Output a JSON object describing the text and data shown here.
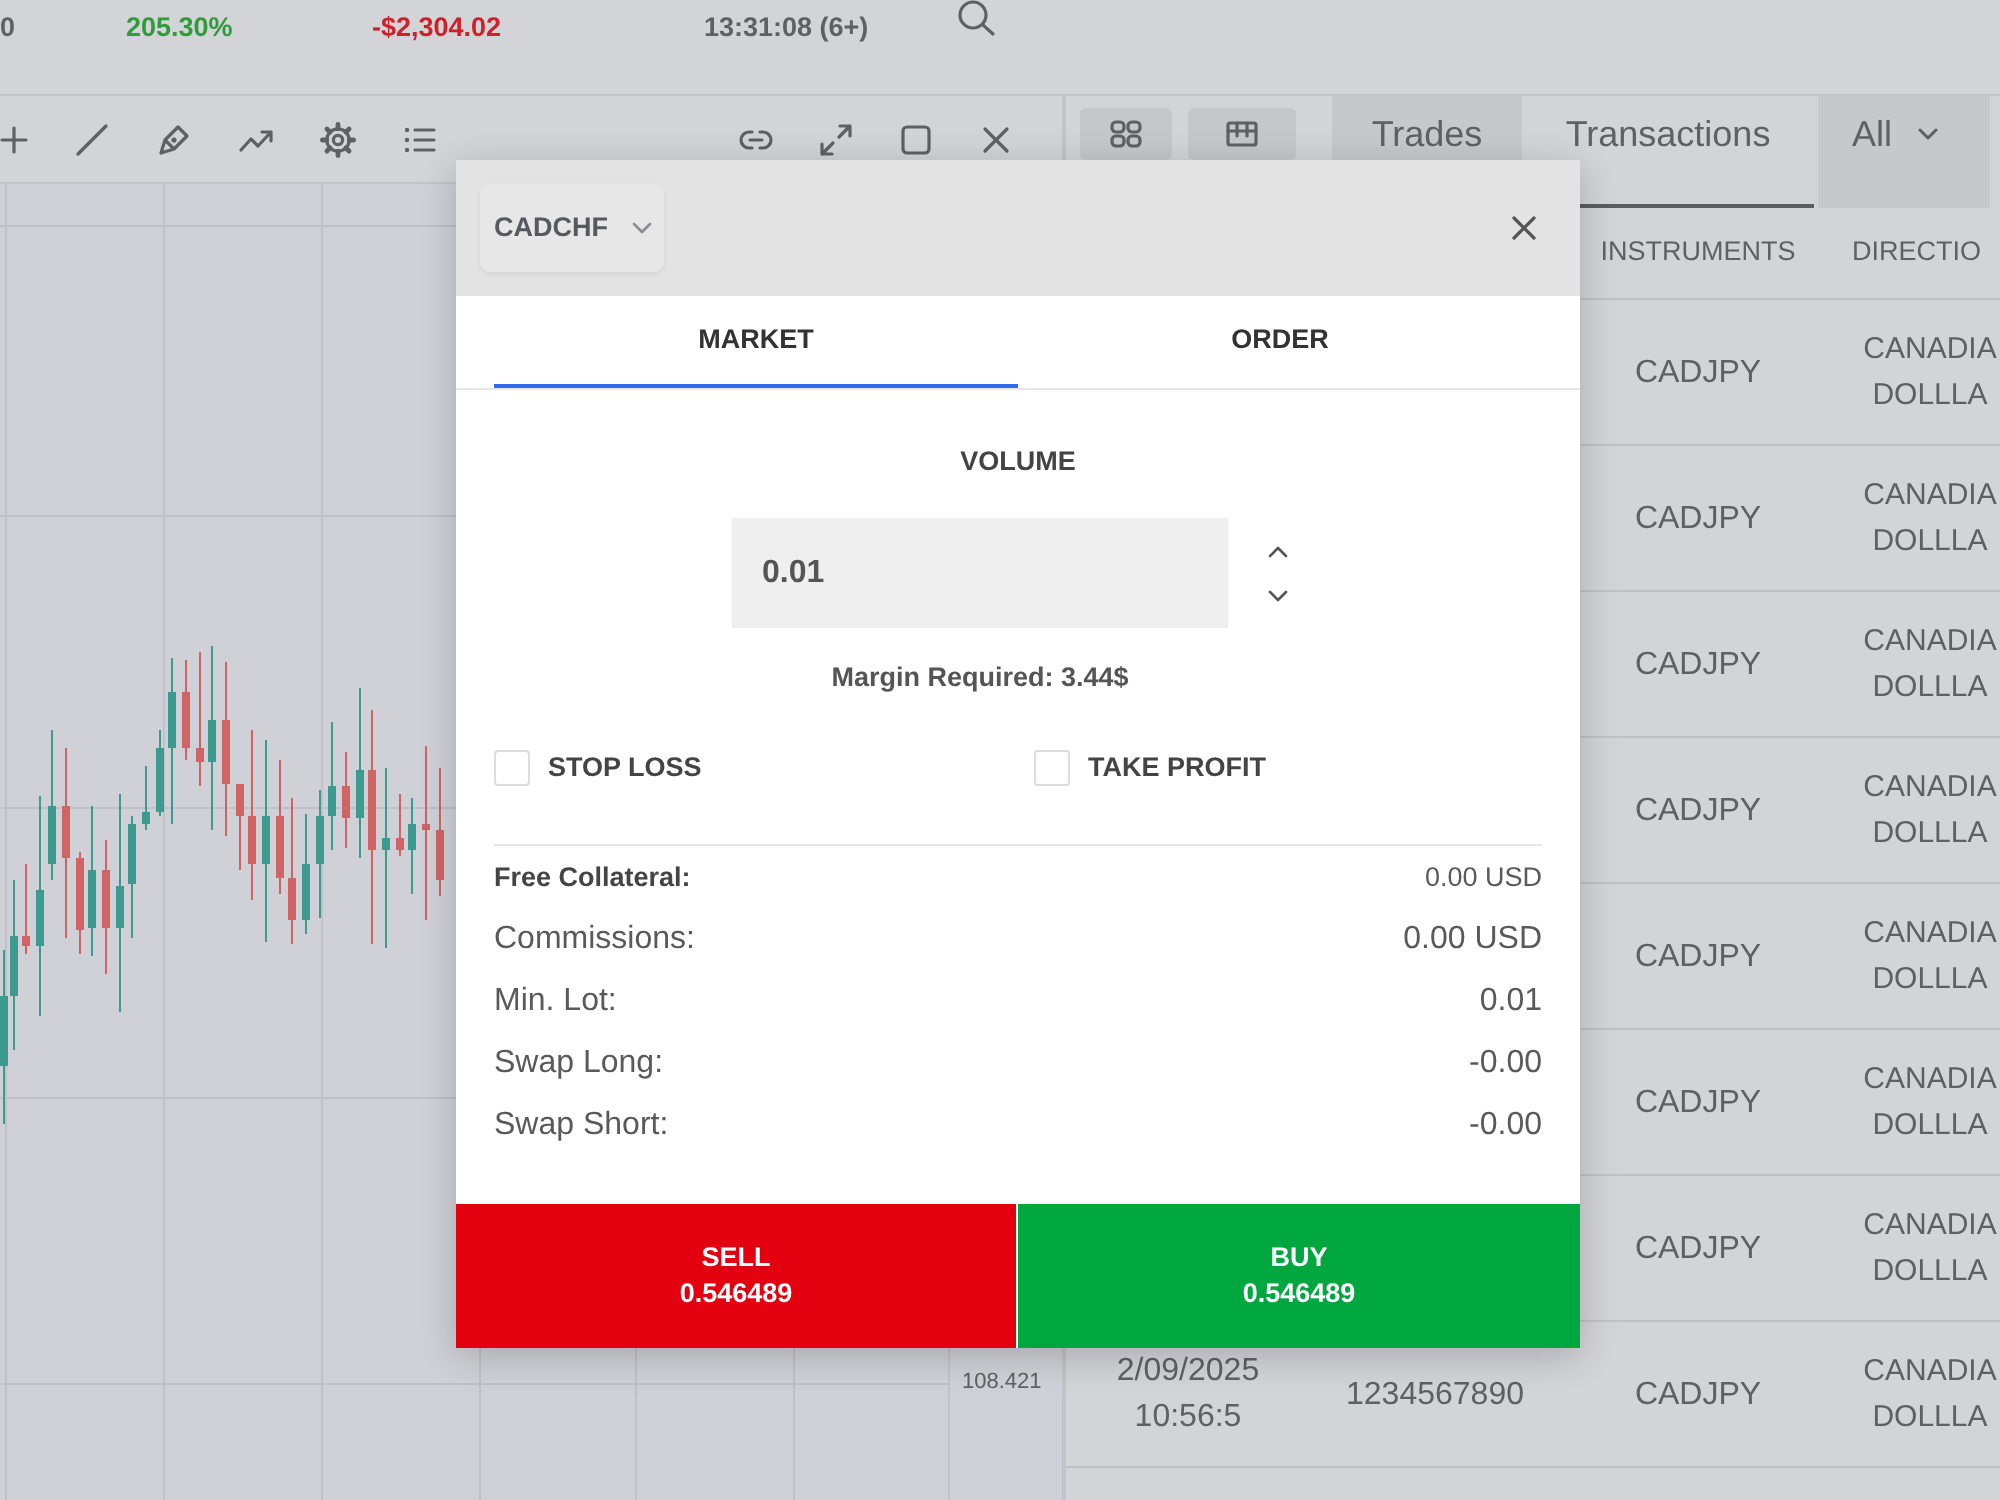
{
  "account_bar": {
    "stats": [
      {
        "value": "0",
        "color": "#5f6064"
      },
      {
        "value": "205.30%",
        "color": "#2f9c3b"
      },
      {
        "value": "-$2,304.02",
        "color": "#cf1f29"
      },
      {
        "value": "13:31:08 (6+)",
        "color": "#5f6064"
      }
    ]
  },
  "chart": {
    "price_label": "108.421"
  },
  "positions_panel": {
    "tabs": [
      {
        "label": "Trades",
        "selected": false
      },
      {
        "label": "Transactions",
        "selected": true
      }
    ],
    "filter": {
      "value": "All"
    },
    "table": {
      "header": {
        "column_3": "INSTRUMENTS",
        "column_4": "DIRECTIO"
      },
      "rows": [
        {
          "column_3": "CADJPY",
          "column_4": "CANADIA DOLLLA"
        },
        {
          "column_3": "CADJPY",
          "column_4": "CANADIA DOLLLA"
        },
        {
          "column_3": "CADJPY",
          "column_4": "CANADIA DOLLLA"
        },
        {
          "column_3": "CADJPY",
          "column_4": "CANADIA DOLLLA"
        },
        {
          "column_3": "CADJPY",
          "column_4": "CANADIA DOLLLA"
        },
        {
          "column_3": "CADJPY",
          "column_4": "CANADIA DOLLLA"
        },
        {
          "column_3": "CADJPY",
          "column_4": "CANADIA DOLLLA"
        },
        {
          "column_1": "2/09/2025 10:56:5",
          "column_2": "1234567890",
          "column_3": "CADJPY",
          "column_4": "CANADIA DOLLLA"
        }
      ]
    }
  },
  "order_dialog": {
    "symbol": "CADCHF",
    "tabs": [
      {
        "label": "MARKET",
        "selected": true
      },
      {
        "label": "ORDER",
        "selected": false
      }
    ],
    "volume": {
      "label": "VOLUME",
      "value": "0.01"
    },
    "margin_required": "Margin Required: 3.44$",
    "options": [
      {
        "label": "STOP LOSS",
        "checked": false
      },
      {
        "label": "TAKE PROFIT",
        "checked": false
      }
    ],
    "details": [
      {
        "kind": "summary",
        "label": "Free Collateral:",
        "value": "0.00 USD"
      },
      {
        "kind": "plain",
        "label": "Commissions:",
        "value": "0.00 USD"
      },
      {
        "kind": "plain",
        "label": "Min. Lot:",
        "value": "0.01"
      },
      {
        "kind": "plain",
        "label": "Swap Long:",
        "value": "-0.00"
      },
      {
        "kind": "plain",
        "label": "Swap Short:",
        "value": "-0.00"
      }
    ],
    "actions": [
      {
        "kind": "sell",
        "label": "SELL",
        "price": "0.546489"
      },
      {
        "kind": "buy",
        "label": "BUY",
        "price": "0.546489"
      }
    ]
  }
}
